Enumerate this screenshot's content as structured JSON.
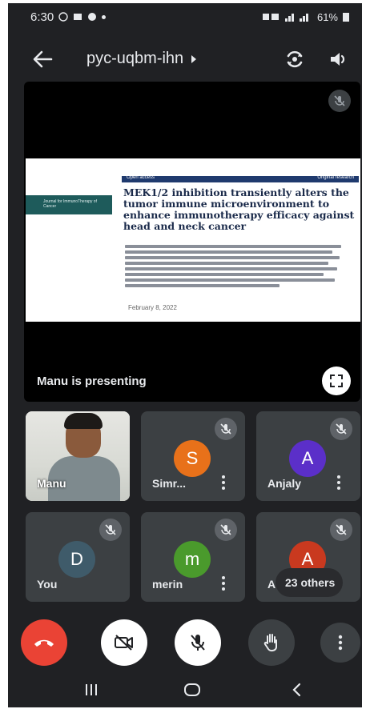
{
  "status_bar": {
    "time": "6:30",
    "battery": "61%"
  },
  "app_bar": {
    "meeting_code": "pyc-uqbm-ihn"
  },
  "presentation": {
    "slide": {
      "header_left": "Open access",
      "header_right": "Original research",
      "journal": "Journal for ImmunoTherapy of Cancer",
      "title": "MEK1/2 inhibition transiently alters the tumor immune microenvironment to enhance immunotherapy efficacy against head and neck cancer",
      "date": "February 8, 2022"
    },
    "presenting_label": "Manu is presenting"
  },
  "participants": [
    {
      "name": "Manu",
      "type": "video"
    },
    {
      "name": "Simr...",
      "initial": "S",
      "avatar_color": "#e8711a"
    },
    {
      "name": "Anjaly",
      "initial": "A",
      "avatar_color": "#5b2fc9"
    },
    {
      "name": "You",
      "initial": "D",
      "avatar_color": "#3f5b6a"
    },
    {
      "name": "merin",
      "initial": "m",
      "avatar_color": "#4a9a2c"
    },
    {
      "name": "A",
      "initial": "A",
      "avatar_color": "#c9391f"
    }
  ],
  "others_chip": "23 others",
  "colors": {
    "background": "#202124",
    "tile": "#3c4043",
    "end_call": "#ea4335"
  }
}
